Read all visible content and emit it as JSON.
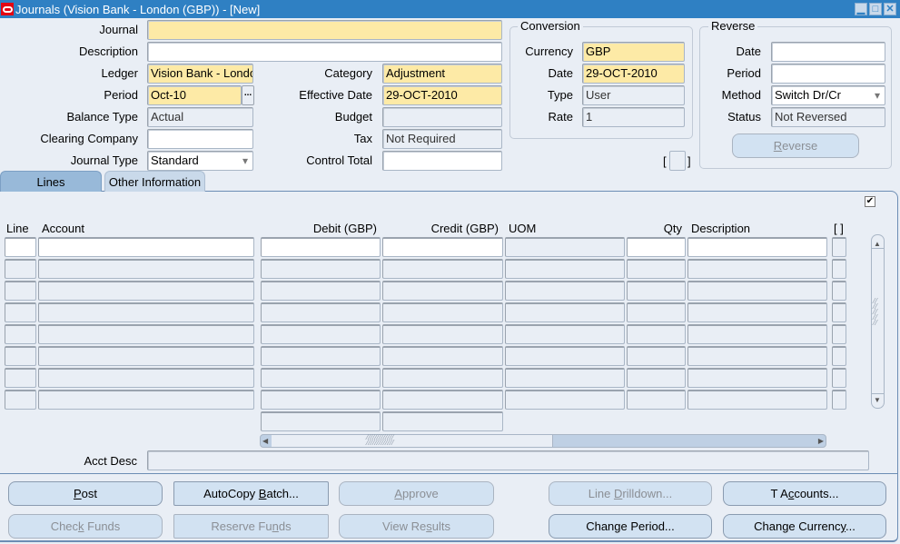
{
  "window": {
    "title": "Journals (Vision Bank - London (GBP)) - [New]",
    "controls": [
      "minimize-icon",
      "maximize-icon",
      "close-icon"
    ]
  },
  "header": {
    "journal": {
      "label": "Journal",
      "value": ""
    },
    "description": {
      "label": "Description",
      "value": ""
    },
    "ledger": {
      "label": "Ledger",
      "value": "Vision Bank - Londo"
    },
    "period": {
      "label": "Period",
      "value": "Oct-10",
      "lov_button": "..."
    },
    "balance_type": {
      "label": "Balance Type",
      "value": "Actual"
    },
    "clearing_company": {
      "label": "Clearing Company",
      "value": ""
    },
    "journal_type": {
      "label": "Journal Type",
      "value": "Standard"
    },
    "category": {
      "label": "Category",
      "value": "Adjustment"
    },
    "effective_date": {
      "label": "Effective Date",
      "value": "29-OCT-2010"
    },
    "budget": {
      "label": "Budget",
      "value": ""
    },
    "tax": {
      "label": "Tax",
      "value": "Not Required"
    },
    "control_total": {
      "label": "Control Total",
      "value": ""
    }
  },
  "conversion": {
    "title": "Conversion",
    "currency": {
      "label": "Currency",
      "value": "GBP"
    },
    "date": {
      "label": "Date",
      "value": "29-OCT-2010"
    },
    "type": {
      "label": "Type",
      "value": "User"
    },
    "rate": {
      "label": "Rate",
      "value": "1"
    }
  },
  "reverse": {
    "title": "Reverse",
    "date": {
      "label": "Date",
      "value": ""
    },
    "period": {
      "label": "Period",
      "value": ""
    },
    "method": {
      "label": "Method",
      "value": "Switch Dr/Cr"
    },
    "status": {
      "label": "Status",
      "value": "Not Reversed"
    },
    "button_pre": "",
    "button_ul": "R",
    "button_post": "everse"
  },
  "dff": {
    "open": "[",
    "close": "]"
  },
  "tabs": [
    {
      "label": "Lines",
      "active": true
    },
    {
      "label": "Other Information",
      "active": false
    }
  ],
  "lines": {
    "columns": {
      "line": "Line",
      "account": "Account",
      "debit": "Debit (GBP)",
      "credit": "Credit (GBP)",
      "uom": "UOM",
      "qty": "Qty",
      "description": "Description",
      "dff": "[ ]"
    },
    "row_count": 8,
    "acct_desc_label": "Acct Desc",
    "acct_desc_value": ""
  },
  "buttons": {
    "post": {
      "pre": "",
      "ul": "P",
      "post": "ost",
      "enabled": true
    },
    "autocopy": {
      "pre": "AutoCopy ",
      "ul": "B",
      "post": "atch...",
      "enabled": true
    },
    "approve": {
      "pre": "",
      "ul": "A",
      "post": "pprove",
      "enabled": false
    },
    "line_drilldown": {
      "pre": "Line ",
      "ul": "D",
      "post": "rilldown...",
      "enabled": false
    },
    "t_accounts": {
      "pre": "T A",
      "ul": "c",
      "post": "counts...",
      "enabled": true
    },
    "check_funds": {
      "pre": "Chec",
      "ul": "k",
      "post": " Funds",
      "enabled": false
    },
    "reserve_funds": {
      "pre": "Reserve Fu",
      "ul": "n",
      "post": "ds",
      "enabled": false
    },
    "view_results": {
      "pre": "View Re",
      "ul": "s",
      "post": "ults",
      "enabled": false
    },
    "change_period": {
      "pre": "Change Period...",
      "ul": "",
      "post": "",
      "enabled": true
    },
    "change_currency": {
      "pre": "Change Currenc",
      "ul": "y",
      "post": "...",
      "enabled": true
    }
  },
  "colors": {
    "titlebar": "#2f80c3",
    "required_field": "#fdeaa6",
    "background": "#e9eef5",
    "button": "#d2e2f2"
  }
}
